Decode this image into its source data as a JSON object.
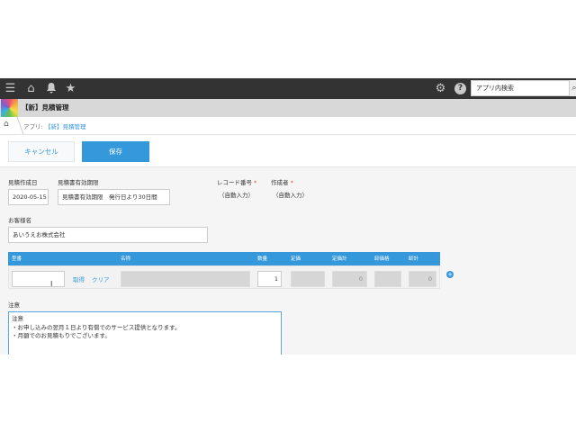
{
  "search": {
    "placeholder": "アプリ内検索"
  },
  "app": {
    "title": "【新】見積管理"
  },
  "breadcrumb": {
    "prefix": "アプリ:",
    "link": "【新】見積管理"
  },
  "actions": {
    "cancel": "キャンセル",
    "save": "保存"
  },
  "form": {
    "created_date": {
      "label": "見積作成日",
      "value": "2020-05-15"
    },
    "validity": {
      "label": "見積書有効期限",
      "value": "見積書有効期限　発行日より30日間"
    },
    "record_no": {
      "label": "レコード番号",
      "required": "*",
      "value": "（自動入力）"
    },
    "author": {
      "label": "作成者",
      "required": "*",
      "value": "（自動入力）"
    },
    "customer": {
      "label": "お客様名",
      "value": "あいうえお株式会社"
    }
  },
  "table": {
    "headers": [
      "型番",
      "名称",
      "数量",
      "定価",
      "定価計",
      "卸価格",
      "卸計"
    ],
    "row": {
      "model": "",
      "fetch": "取得",
      "clear": "クリア",
      "name": "",
      "qty": "1",
      "list_price": "",
      "list_total": "0",
      "wholesale": "",
      "wholesale_total": "0"
    },
    "add": "+"
  },
  "notes": {
    "label": "注意",
    "lines": [
      "注意",
      "・お申し込みの翌月１日より有償でのサービス提供となります。",
      "・月額でのお見積もりでございます。"
    ]
  },
  "colors": {
    "primary": "#3498db",
    "topbar": "#333333"
  }
}
